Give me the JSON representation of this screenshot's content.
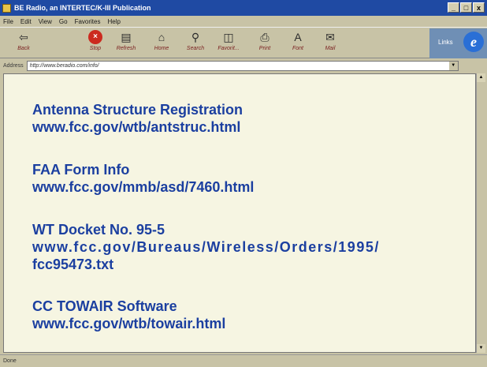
{
  "window": {
    "title": "BE Radio, an INTERTEC/K-III Publication",
    "controls": [
      "_",
      "□",
      "x"
    ]
  },
  "menu": [
    "File",
    "Edit",
    "View",
    "Go",
    "Favorites",
    "Help"
  ],
  "toolbar": {
    "back": "Back",
    "stop": "Stop",
    "refresh": "Refresh",
    "home": "Home",
    "search": "Search",
    "favorites": "Favorit...",
    "print": "Print",
    "font": "Font",
    "mail": "Mail",
    "links": "Links"
  },
  "address": {
    "label": "Address",
    "value": "http://www.beradio.com/info/"
  },
  "content": {
    "entries": [
      {
        "title": "Antenna Structure Registration",
        "url": "www.fcc.gov/wtb/antstruc.html"
      },
      {
        "title": "FAA Form Info",
        "url": "www.fcc.gov/mmb/asd/7460.html"
      },
      {
        "title": "WT Docket No. 95-5",
        "url": "www.fcc.gov/Bureaus/Wireless/Orders/1995/",
        "url2": "fcc95473.txt"
      },
      {
        "title": "CC TOWAIR Software",
        "url": "www.fcc.gov/wtb/towair.html"
      }
    ]
  },
  "status": {
    "text": "Done"
  },
  "colors": {
    "titlebar": "#1f4aa3",
    "link_text": "#1b3fa0",
    "content_bg": "#f6f5e2"
  }
}
